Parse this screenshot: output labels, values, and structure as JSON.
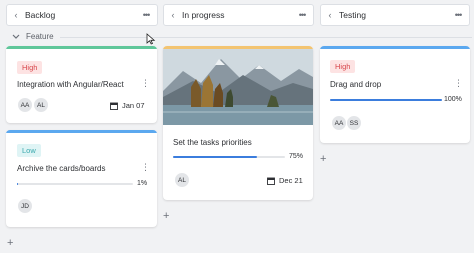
{
  "columns": [
    {
      "title": "Backlog"
    },
    {
      "title": "In progress"
    },
    {
      "title": "Testing"
    }
  ],
  "group": {
    "label": "Feature"
  },
  "colors": {
    "green": "#5fc79a",
    "blue": "#5ba8ef",
    "orange": "#f3c471",
    "progress": "#3b7ddd"
  },
  "cards": {
    "c1": {
      "tag": "High",
      "title": "Integration with Angular/React",
      "avatars": [
        "AA",
        "AL"
      ],
      "date": "Jan 07"
    },
    "c2": {
      "tag": "Low",
      "title": "Archive the cards/boards",
      "progress": 1,
      "progress_label": "1%",
      "avatars": [
        "JD"
      ]
    },
    "c3": {
      "title": "Set the tasks priorities",
      "progress": 75,
      "progress_label": "75%",
      "avatars": [
        "AL"
      ],
      "date": "Dec 21"
    },
    "c4": {
      "tag": "High",
      "title": "Drag and drop",
      "progress": 100,
      "progress_label": "100%",
      "avatars": [
        "AA",
        "SS"
      ]
    }
  },
  "icons": {
    "back": "chevron-left-icon",
    "more": "more-horizontal-icon",
    "collapse": "chevron-down-icon",
    "calendar": "calendar-icon",
    "add": "plus-icon",
    "card_menu": "more-vertical-icon"
  }
}
